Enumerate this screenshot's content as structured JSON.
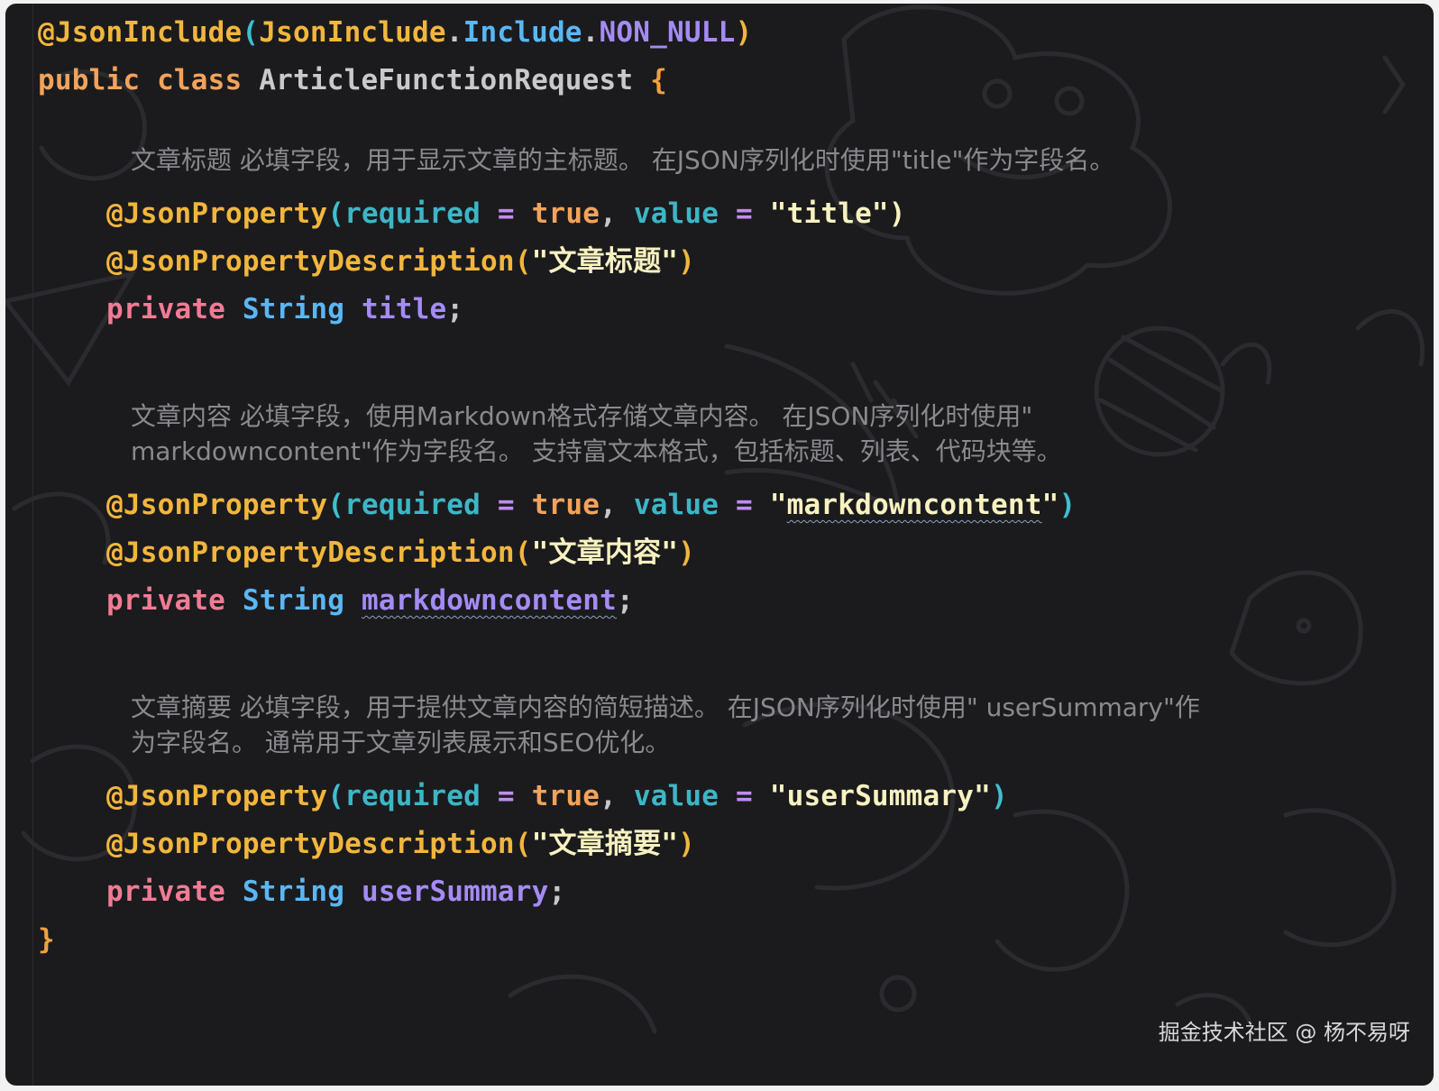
{
  "editor": {
    "header": {
      "ann_include": "@JsonInclude",
      "include_open": "(",
      "include_class": "JsonInclude",
      "dot1": ".",
      "include_member": "Include",
      "dot2": ".",
      "include_value": "NON_NULL",
      "include_close": ")",
      "kw_public": "public",
      "kw_class": "class",
      "class_name": "ArticleFunctionRequest",
      "open_brace": "{"
    },
    "fields": [
      {
        "doc": "文章标题 必填字段，用于显示文章的主标题。 在JSON序列化时使用\"title\"作为字段名。",
        "ann_property": "@JsonProperty",
        "p_open": "(",
        "param_required": "required",
        "eq1": " = ",
        "val_true": "true",
        "comma": ", ",
        "param_value": "value",
        "eq2": " = ",
        "value_str": "\"title\"",
        "p_close": ")",
        "ann_description": "@JsonPropertyDescription",
        "d_open": "(",
        "description_str": "\"文章标题\"",
        "d_close": ")",
        "kw_private": "private",
        "type": "String",
        "name": "title",
        "semicolon": ";"
      },
      {
        "doc": "文章内容 必填字段，使用Markdown格式存储文章内容。 在JSON序列化时使用\" markdowncontent\"作为字段名。 支持富文本格式，包括标题、列表、代码块等。",
        "ann_property": "@JsonProperty",
        "p_open": "(",
        "param_required": "required",
        "eq1": " = ",
        "val_true": "true",
        "comma": ", ",
        "param_value": "value",
        "eq2": " = ",
        "value_quote_open": "\"",
        "value_str": "markdowncontent",
        "value_quote_close": "\"",
        "p_close": ")",
        "ann_description": "@JsonPropertyDescription",
        "d_open": "(",
        "description_str": "\"文章内容\"",
        "d_close": ")",
        "kw_private": "private",
        "type": "String",
        "name": "markdowncontent",
        "semicolon": ";"
      },
      {
        "doc": "文章摘要 必填字段，用于提供文章内容的简短描述。 在JSON序列化时使用\" userSummary\"作为字段名。 通常用于文章列表展示和SEO优化。",
        "ann_property": "@JsonProperty",
        "p_open": "(",
        "param_required": "required",
        "eq1": " = ",
        "val_true": "true",
        "comma": ", ",
        "param_value": "value",
        "eq2": " = ",
        "value_str": "\"userSummary\"",
        "p_close": ")",
        "ann_description": "@JsonPropertyDescription",
        "d_open": "(",
        "description_str": "\"文章摘要\"",
        "d_close": ")",
        "kw_private": "private",
        "type": "String",
        "name": "userSummary",
        "semicolon": ";"
      }
    ],
    "close_brace": "}"
  },
  "watermark": "掘金技术社区 @ 杨不易呀",
  "colors": {
    "background": "#1b1b1e",
    "annotation": "#f2b63c",
    "keyword_private": "#f27b94",
    "keyword_public": "#f2a35a",
    "type": "#5ab7f5",
    "field": "#a58bf5",
    "string": "#f7f2c0",
    "parameter": "#3cb6c6",
    "doc_comment": "#8a8a8e"
  }
}
